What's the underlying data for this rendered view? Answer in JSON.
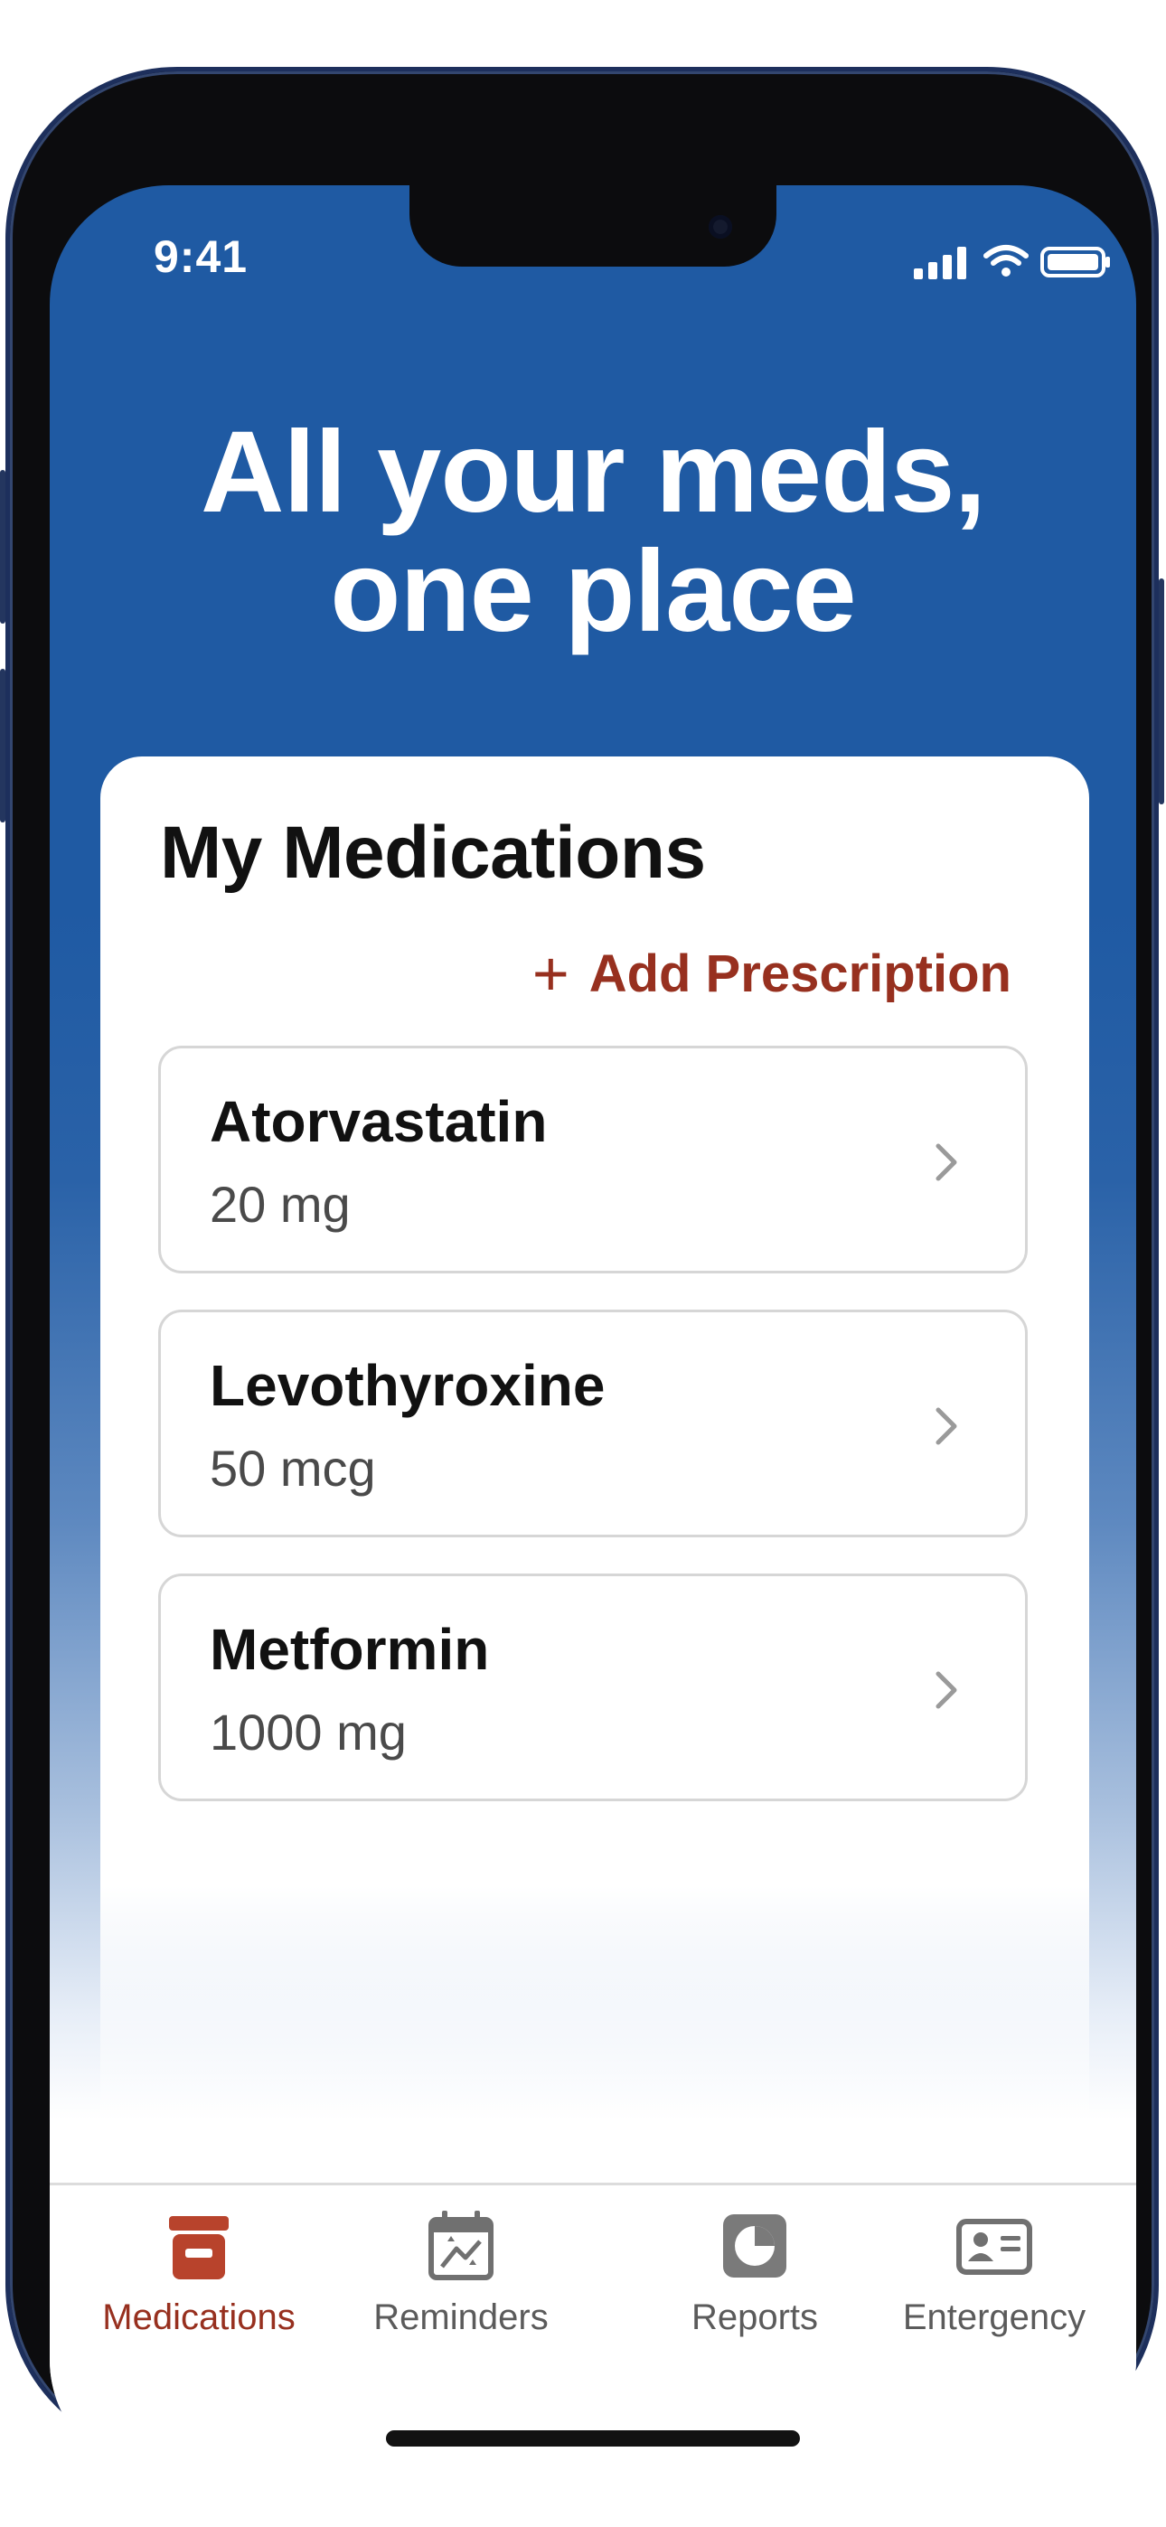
{
  "status_bar": {
    "time": "9:41"
  },
  "hero": {
    "headline_line1": "All your meds,",
    "headline_line2": "one place"
  },
  "medications_card": {
    "title": "My Medications",
    "add_label": "Add Prescription",
    "add_icon": "plus-icon",
    "items": [
      {
        "name": "Atorvastatin",
        "dose": "20 mg"
      },
      {
        "name": "Levothyroxine",
        "dose": "50 mcg"
      },
      {
        "name": "Metformin",
        "dose": "1000 mg"
      }
    ]
  },
  "tab_bar": {
    "tabs": [
      {
        "label": "Medications",
        "icon": "pill-bottle-icon",
        "active": true
      },
      {
        "label": "Reminders",
        "icon": "calendar-icon",
        "active": false
      },
      {
        "label": "Reports",
        "icon": "pie-chart-icon",
        "active": false
      },
      {
        "label": "Entergency",
        "icon": "id-card-icon",
        "active": false
      }
    ]
  },
  "colors": {
    "header_blue": "#1f5aa3",
    "accent_red": "#97301f",
    "inactive_gray": "#5b5b5b"
  }
}
